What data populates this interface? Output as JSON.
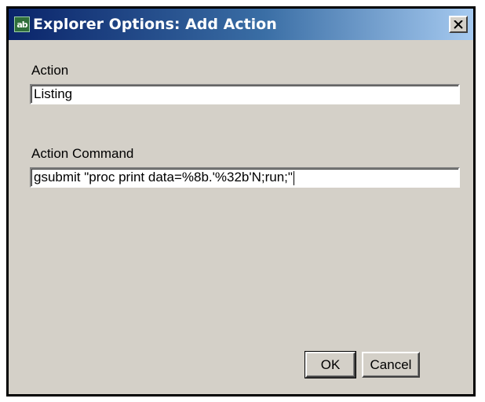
{
  "window": {
    "title": "Explorer Options: Add Action",
    "icon": "sas-app-icon",
    "icon_text": "ab"
  },
  "fields": {
    "action_label": "Action",
    "action_value": "Listing",
    "command_label": "Action Command",
    "command_value": "gsubmit \"proc print data=%8b.'%32b'N;run;\""
  },
  "buttons": {
    "ok_label": "OK",
    "cancel_label": "Cancel"
  },
  "colors": {
    "titlebar_start": "#0a246a",
    "titlebar_end": "#a6caf0",
    "dialog_face": "#d4d0c8"
  }
}
